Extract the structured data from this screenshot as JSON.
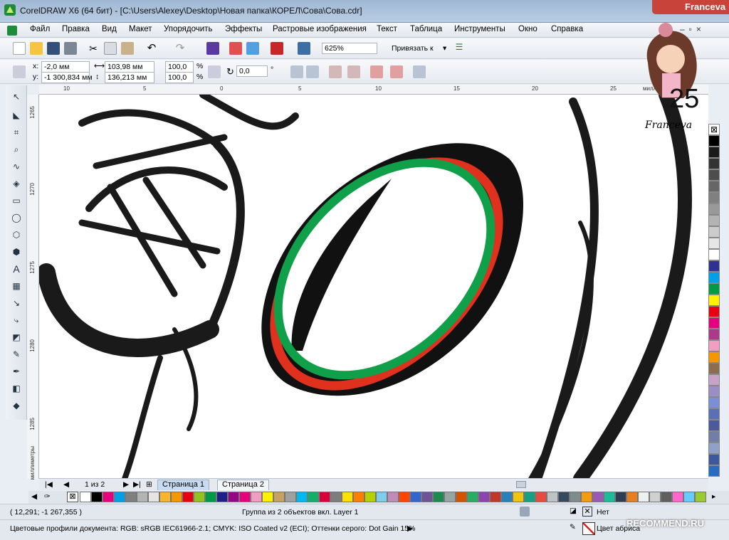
{
  "title": {
    "text": "CorelDRAW X6 (64 бит) - [C:\\Users\\Alexey\\Desktop\\Новая папка\\КОРЕЛ\\Сова\\Сова.cdr]",
    "user": "Franceva"
  },
  "menu": [
    "Файл",
    "Правка",
    "Вид",
    "Макет",
    "Упорядочить",
    "Эффекты",
    "Растровые изображения",
    "Текст",
    "Таблица",
    "Инструменты",
    "Окно",
    "Справка"
  ],
  "toolbar": {
    "zoom": "625%",
    "snap": "Привязать к"
  },
  "propbar": {
    "x_label": "x:",
    "x": "-2,0 мм",
    "y_label": "y:",
    "y": "-1 300,834 мм",
    "w": "103,98 мм",
    "h": "136,213 мм",
    "sx": "100,0",
    "sy": "100,0",
    "pct": "%",
    "angle": "0,0",
    "deg": "°"
  },
  "ruler": {
    "h_ticks": [
      "10",
      "5",
      "0",
      "5",
      "10",
      "15",
      "20",
      "25"
    ],
    "h_unit": "миллиметры",
    "v_ticks": [
      "1265",
      "1270",
      "1275",
      "1280",
      "1285"
    ],
    "v_unit": "миллиметры"
  },
  "pages": {
    "counter": "1 из 2",
    "tab1": "Страница 1",
    "tab2": "Страница 2"
  },
  "status": {
    "coords": "( 12,291; -1 267,355 )",
    "selection": "Группа из 2 объектов вкл. Layer 1",
    "profiles": "Цветовые профили документа: RGB: sRGB IEC61966-2.1; CMYK: ISO Coated v2 (ECI); Оттенки серого: Dot Gain 15%",
    "fill": "Нет",
    "outline": "Цвет абриса"
  },
  "sticker": {
    "number": "25",
    "name": "Franceva"
  },
  "watermark": "RECOMMEND.RU",
  "colors": {
    "red_ellipse": "#e0301e",
    "green_ellipse": "#11a04a",
    "accent": "#2a6bbf"
  },
  "palette_h": [
    "#ffffff",
    "#000000",
    "#e6007e",
    "#00a0e9",
    "#808080",
    "#b3b3b3",
    "#e5e5e5",
    "#f8b62d",
    "#f39800",
    "#e60012",
    "#8fc31f",
    "#009944",
    "#1d2088",
    "#920783",
    "#e4007f",
    "#f19ec2",
    "#fff100",
    "#c9a063",
    "#a0a0a0",
    "#00b7ee",
    "#13ae67",
    "#d7003a",
    "#7d7d7d",
    "#ffe100",
    "#ff7f00",
    "#b6d100",
    "#7fcdea",
    "#c28ab9",
    "#ff4500",
    "#3366cc",
    "#6e5494",
    "#1b8a4c",
    "#95a5a6",
    "#d35400",
    "#27ae60",
    "#8e44ad",
    "#c0392b",
    "#2980b9",
    "#f1c40f",
    "#16a085",
    "#e74c3c",
    "#bdc3c7",
    "#34495e",
    "#7f8c8d",
    "#f39c12",
    "#9b59b6",
    "#1abc9c",
    "#2c3e50",
    "#e67e22",
    "#ecf0f1",
    "#d0d0d0",
    "#606060",
    "#ff66cc",
    "#66ccff",
    "#99cc33"
  ],
  "palette_v": [
    "#000000",
    "#1a1a1a",
    "#333333",
    "#4d4d4d",
    "#666666",
    "#808080",
    "#999999",
    "#b3b3b3",
    "#cccccc",
    "#e6e6e6",
    "#ffffff",
    "#2e3192",
    "#00a0e9",
    "#009944",
    "#fff100",
    "#e60012",
    "#e4007f",
    "#ab3a8a",
    "#f19ec2",
    "#f39800",
    "#8b6e4e",
    "#c8a2c8",
    "#9b8ec4",
    "#7b8ed6",
    "#5a6fb5",
    "#4a5a9a",
    "#6f7fa8",
    "#8fa1c8",
    "#3c5a9a",
    "#2a6bbf"
  ]
}
